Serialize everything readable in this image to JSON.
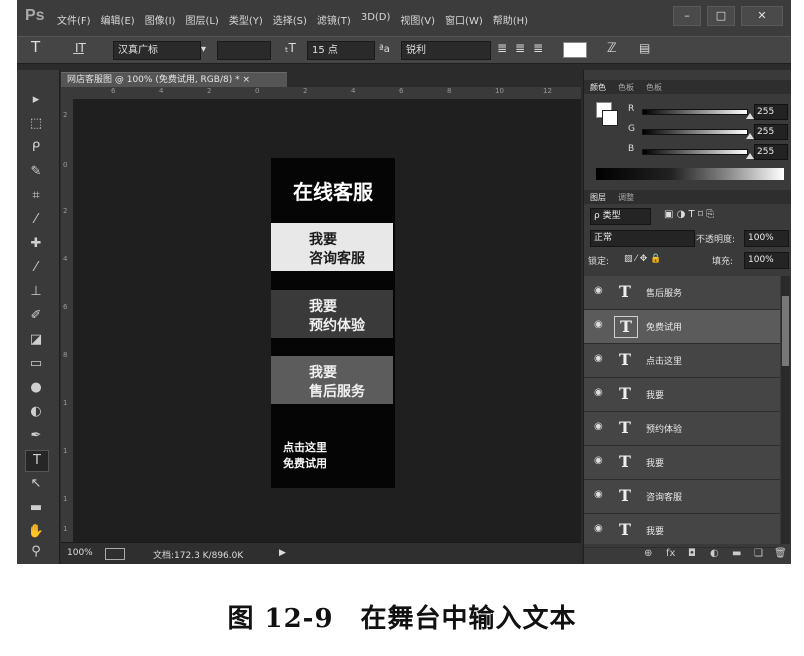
{
  "app": {
    "logo": "Ps"
  },
  "menu": [
    "文件(F)",
    "编辑(E)",
    "图像(I)",
    "图层(L)",
    "类型(Y)",
    "选择(S)",
    "滤镜(T)",
    "3D(D)",
    "视图(V)",
    "窗口(W)",
    "帮助(H)"
  ],
  "window_buttons": {
    "minimize": "–",
    "maximize": "□",
    "close": "✕"
  },
  "options": {
    "tool": "T",
    "font_family": "汉真广标",
    "font_size": "15 点",
    "aa_label": "ªa",
    "antialias": "锐利"
  },
  "document": {
    "tab": "网店客服图 @ 100% (免费试用, RGB/8) * ×",
    "zoom": "100%",
    "doc_size": "文档:172.3 K/896.0K",
    "ruler_h_ticks": [
      "6",
      "4",
      "2",
      "0",
      "2",
      "4",
      "6",
      "8",
      "10",
      "12"
    ],
    "ruler_v_ticks": [
      "2",
      "0",
      "2",
      "4",
      "6",
      "8",
      "1",
      "1",
      "1",
      "1"
    ]
  },
  "artboard": {
    "title": "在线客服",
    "buttons": [
      {
        "line1": "我要",
        "line2": "咨询客服"
      },
      {
        "line1": "我要",
        "line2": "预约体验"
      },
      {
        "line1": "我要",
        "line2": "售后服务"
      }
    ],
    "click_line1": "点击这里",
    "click_line2": "免费试用"
  },
  "color_panel": {
    "tabs": [
      "颜色",
      "色板",
      "色板"
    ],
    "r_label": "R",
    "g_label": "G",
    "b_label": "B",
    "r": "255",
    "g": "255",
    "b": "255"
  },
  "layers_panel": {
    "tabs": [
      "图层",
      "调整"
    ],
    "filter": "ρ 类型",
    "blend_mode": "正常",
    "opacity_label": "不透明度:",
    "opacity": "100%",
    "lock_label": "锁定:",
    "fill_label": "填充:",
    "fill": "100%",
    "layers": [
      {
        "name": "售后服务",
        "selected": false
      },
      {
        "name": "免费试用",
        "selected": true
      },
      {
        "name": "点击这里",
        "selected": false
      },
      {
        "name": "我要",
        "selected": false
      },
      {
        "name": "预约体验",
        "selected": false
      },
      {
        "name": "我要",
        "selected": false
      },
      {
        "name": "咨询客服",
        "selected": false
      },
      {
        "name": "我要",
        "selected": false
      }
    ],
    "footer_icons": [
      "⊕",
      "fx",
      "◘",
      "◐",
      "▬",
      "❏",
      "🗑"
    ]
  },
  "caption": "图 12-9　在舞台中输入文本"
}
